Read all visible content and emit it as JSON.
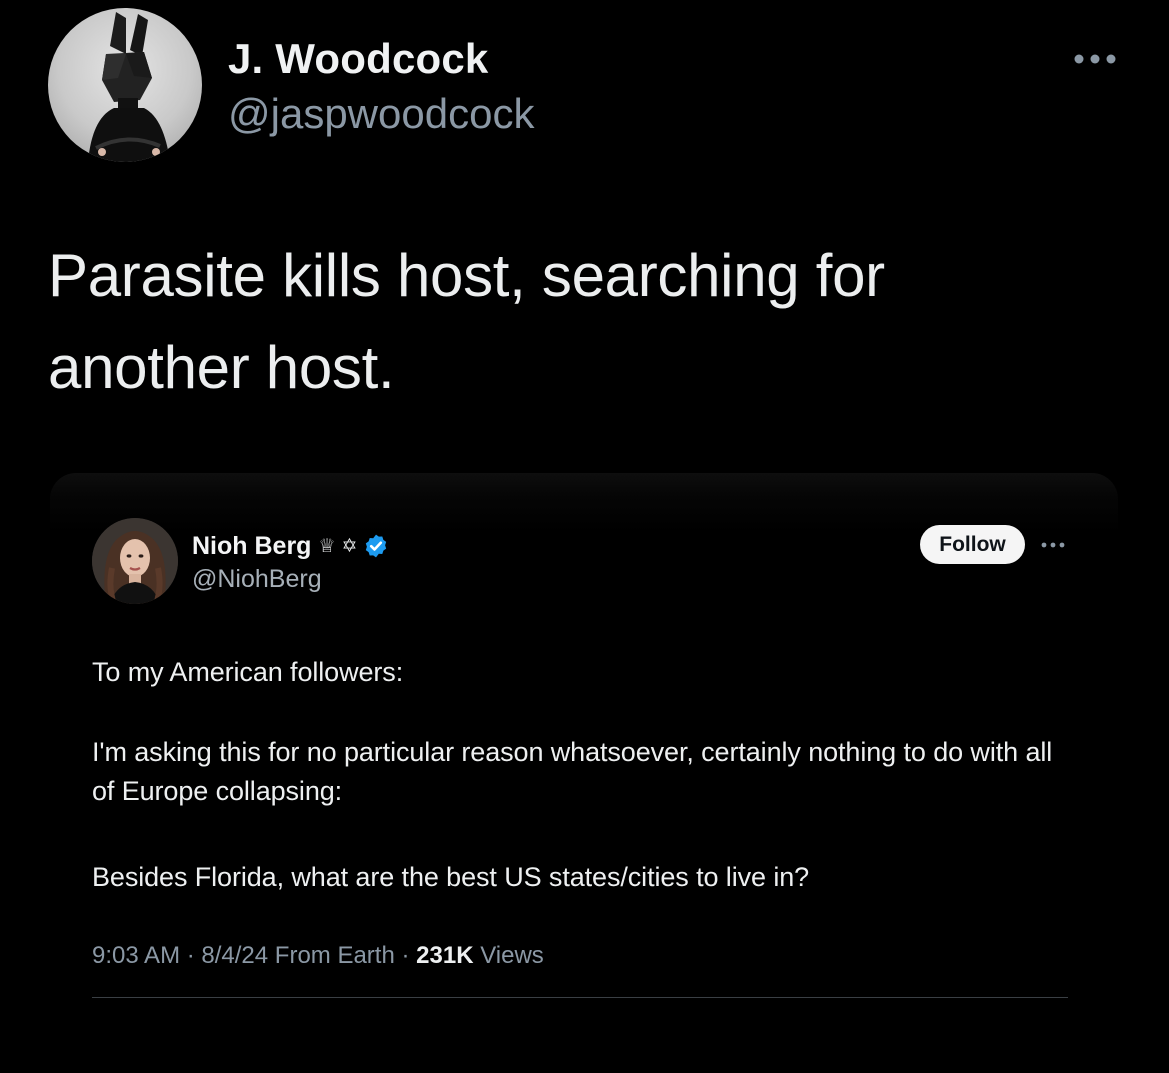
{
  "author": {
    "display_name": "J. Woodcock",
    "handle": "@jaspwoodcock",
    "avatar": "rabbit-mask-avatar"
  },
  "tweet": {
    "text": "Parasite kills host, searching for another host.",
    "more_icon": "more-horizontal-icon"
  },
  "quoted_tweet": {
    "display_name": "Nioh Berg",
    "name_emojis": "♕ ✡",
    "verified_icon": "verified-badge-icon",
    "verified_color": "#1d9bf0",
    "handle": "@NiohBerg",
    "follow_label": "Follow",
    "more_icon": "more-horizontal-icon",
    "paragraphs": [
      "To my American followers:",
      "I'm asking this for no particular reason whatsoever, certainly nothing to do with all of Europe collapsing:",
      "Besides Florida, what are the best US states/cities to live in?"
    ],
    "meta": {
      "time": "9:03 AM",
      "sep1": " · ",
      "date": "8/4/24",
      "source": " From Earth",
      "sep2": " · ",
      "views_count": "231K",
      "views_label": " Views"
    }
  }
}
